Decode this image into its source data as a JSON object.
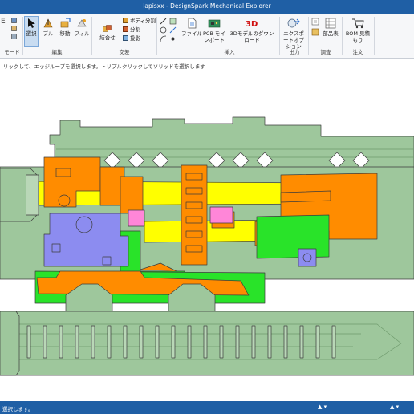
{
  "window": {
    "title": "lapisxx - DesignSpark Mechanical Explorer"
  },
  "ribbon": {
    "mode_label": "モード",
    "select_label": "選択",
    "pull_label": "プル",
    "move_label": "移動",
    "fill_label": "フィル",
    "edit_group": "編集",
    "combine_label": "結合せ",
    "split_body_label": "ボディ分割",
    "split_label": "分割",
    "project_label": "投影",
    "intersect_group": "交差",
    "file_label": "ファイル",
    "pcb_import_label": "PCB をインポート",
    "download_3d_label": "3Dモデルのダウンロード",
    "insert_group": "挿入",
    "export_options_label": "エクスポートオプション",
    "output_group": "出力",
    "parts_table_label": "部品表",
    "procure_group": "調査",
    "bom_quote_label": "BOM 見積もり",
    "order_group": "注文",
    "badge_3d": "3D"
  },
  "hint": {
    "text": "リックして、エッジループを選択します。トリプルクリックしてソリッドを選択します"
  },
  "status": {
    "text": "選択します。"
  },
  "colors": {
    "titlebar": "#1f5fa5",
    "grey_green": "#9ec79c",
    "green": "#29e329",
    "orange": "#ff8c00",
    "yellow": "#ffff00",
    "violet": "#8c8cf0",
    "pink": "#ff86d8",
    "outline": "#3c3c3c"
  },
  "icons": [
    "select-arrow-icon",
    "pull-icon",
    "move-icon",
    "fill-icon",
    "combine-icon",
    "file-icon",
    "pcb-icon",
    "download-3d-icon",
    "export-icon",
    "parts-table-icon",
    "bom-cart-icon"
  ]
}
